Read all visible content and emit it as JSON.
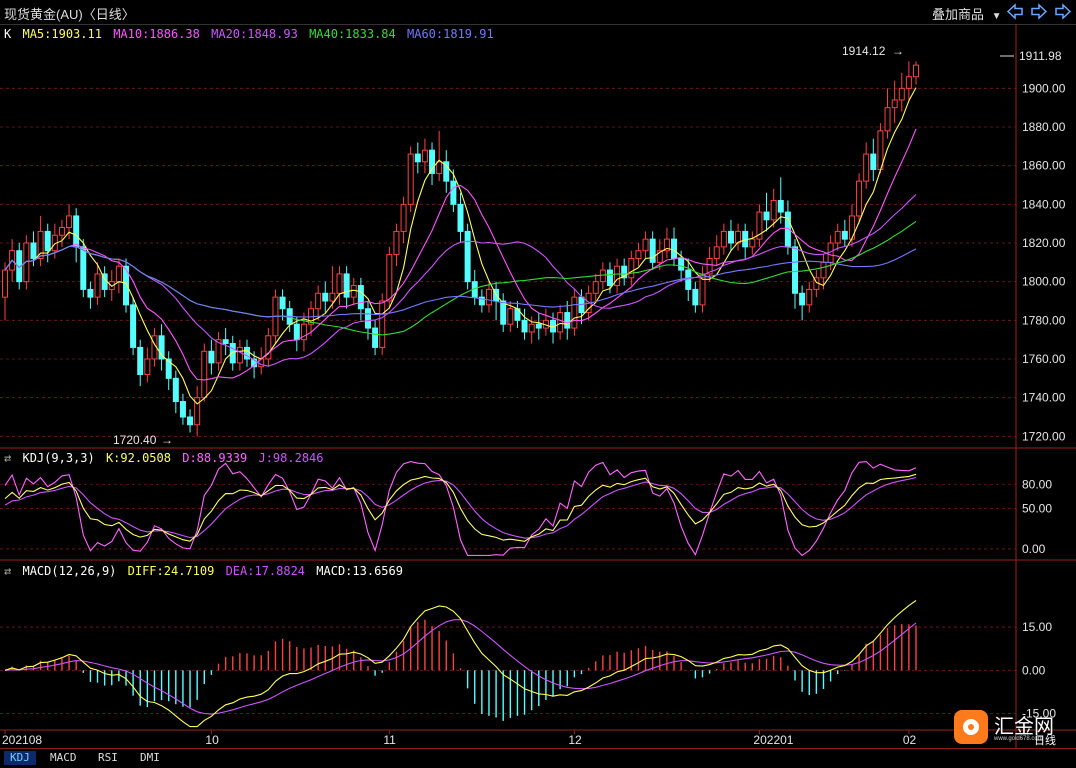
{
  "header": {
    "title": "现货黄金(AU)〈日线〉",
    "overlay_label": "叠加商品"
  },
  "main_legend": {
    "k": "K",
    "ma5": "MA5:1903.11",
    "ma10": "MA10:1886.38",
    "ma20": "MA20:1848.93",
    "ma40": "MA40:1833.84",
    "ma60": "MA60:1819.91"
  },
  "kdj_legend": {
    "name": "KDJ(9,3,3)",
    "k": "K:92.0508",
    "d": "D:88.9339",
    "j": "J:98.2846"
  },
  "macd_legend": {
    "name": "MACD(12,26,9)",
    "diff": "DIFF:24.7109",
    "dea": "DEA:17.8824",
    "macd": "MACD:13.6569"
  },
  "annotations": {
    "high": "1914.12",
    "low": "1720.40",
    "last_price": "1911.98"
  },
  "date_labels": [
    "202108",
    "10",
    "11",
    "12",
    "202201",
    "02"
  ],
  "tabs": [
    "KDJ",
    "MACD",
    "RSI",
    "DMI"
  ],
  "logo": {
    "text": "汇金网",
    "url": "www.gold678.com",
    "period": "日线"
  },
  "colors": {
    "up": "#ff4040",
    "down": "#54ffff",
    "ma5": "#ffff55",
    "ma10": "#ff55ff",
    "ma20": "#cc55ff",
    "ma40": "#33dd33",
    "ma60": "#7777ff",
    "kdj_k": "#ffff66",
    "kdj_d": "#ff66ff",
    "kdj_j": "#cc55ff",
    "diff": "#ffff55",
    "dea": "#cc55ff"
  },
  "chart_data": [
    {
      "type": "candlestick",
      "title": "现货黄金(AU) 日线",
      "ylim": [
        1715,
        1925
      ],
      "yticks": [
        1720,
        1740,
        1760,
        1780,
        1800,
        1820,
        1840,
        1860,
        1880,
        1900
      ],
      "ytick_labels": [
        "1720.00",
        "1740.00",
        "1760.00",
        "1780.00",
        "1800.00",
        "1820.00",
        "1840.00",
        "1860.00",
        "1880.00",
        "1900.00"
      ],
      "candles": [
        [
          1792,
          1806,
          1780,
          1810
        ],
        [
          1806,
          1816,
          1800,
          1822
        ],
        [
          1816,
          1800,
          1796,
          1820
        ],
        [
          1800,
          1820,
          1796,
          1824
        ],
        [
          1820,
          1812,
          1808,
          1826
        ],
        [
          1812,
          1826,
          1808,
          1834
        ],
        [
          1826,
          1816,
          1810,
          1830
        ],
        [
          1816,
          1824,
          1812,
          1830
        ],
        [
          1824,
          1828,
          1818,
          1832
        ],
        [
          1828,
          1834,
          1822,
          1840
        ],
        [
          1834,
          1818,
          1810,
          1838
        ],
        [
          1818,
          1796,
          1792,
          1822
        ],
        [
          1796,
          1792,
          1786,
          1800
        ],
        [
          1792,
          1804,
          1788,
          1810
        ],
        [
          1804,
          1796,
          1792,
          1808
        ],
        [
          1796,
          1800,
          1790,
          1806
        ],
        [
          1800,
          1808,
          1794,
          1812
        ],
        [
          1808,
          1788,
          1784,
          1812
        ],
        [
          1788,
          1766,
          1762,
          1792
        ],
        [
          1766,
          1752,
          1746,
          1770
        ],
        [
          1752,
          1760,
          1748,
          1766
        ],
        [
          1760,
          1772,
          1756,
          1776
        ],
        [
          1772,
          1760,
          1754,
          1778
        ],
        [
          1760,
          1750,
          1744,
          1764
        ],
        [
          1750,
          1738,
          1732,
          1754
        ],
        [
          1738,
          1730,
          1726,
          1742
        ],
        [
          1730,
          1726,
          1722,
          1734
        ],
        [
          1726,
          1740,
          1720,
          1746
        ],
        [
          1740,
          1764,
          1738,
          1768
        ],
        [
          1764,
          1758,
          1752,
          1770
        ],
        [
          1758,
          1770,
          1754,
          1774
        ],
        [
          1770,
          1768,
          1762,
          1776
        ],
        [
          1768,
          1758,
          1754,
          1772
        ],
        [
          1758,
          1766,
          1754,
          1770
        ],
        [
          1766,
          1760,
          1756,
          1770
        ],
        [
          1760,
          1756,
          1750,
          1764
        ],
        [
          1756,
          1760,
          1752,
          1766
        ],
        [
          1760,
          1772,
          1756,
          1776
        ],
        [
          1772,
          1792,
          1768,
          1796
        ],
        [
          1792,
          1786,
          1780,
          1796
        ],
        [
          1786,
          1778,
          1774,
          1790
        ],
        [
          1778,
          1770,
          1764,
          1782
        ],
        [
          1770,
          1778,
          1764,
          1784
        ],
        [
          1778,
          1786,
          1772,
          1790
        ],
        [
          1786,
          1794,
          1780,
          1798
        ],
        [
          1794,
          1790,
          1784,
          1800
        ],
        [
          1790,
          1794,
          1786,
          1808
        ],
        [
          1794,
          1804,
          1788,
          1808
        ],
        [
          1804,
          1792,
          1786,
          1808
        ],
        [
          1792,
          1798,
          1788,
          1802
        ],
        [
          1798,
          1786,
          1780,
          1802
        ],
        [
          1786,
          1776,
          1770,
          1790
        ],
        [
          1776,
          1766,
          1762,
          1780
        ],
        [
          1766,
          1790,
          1762,
          1794
        ],
        [
          1790,
          1814,
          1786,
          1818
        ],
        [
          1814,
          1826,
          1808,
          1830
        ],
        [
          1826,
          1840,
          1820,
          1844
        ],
        [
          1840,
          1866,
          1836,
          1870
        ],
        [
          1866,
          1862,
          1856,
          1872
        ],
        [
          1862,
          1868,
          1856,
          1874
        ],
        [
          1868,
          1856,
          1850,
          1872
        ],
        [
          1856,
          1862,
          1852,
          1878
        ],
        [
          1862,
          1852,
          1846,
          1868
        ],
        [
          1852,
          1840,
          1836,
          1858
        ],
        [
          1840,
          1826,
          1820,
          1846
        ],
        [
          1826,
          1800,
          1796,
          1830
        ],
        [
          1800,
          1792,
          1788,
          1806
        ],
        [
          1792,
          1788,
          1784,
          1796
        ],
        [
          1788,
          1796,
          1784,
          1800
        ],
        [
          1796,
          1790,
          1780,
          1800
        ],
        [
          1790,
          1778,
          1774,
          1794
        ],
        [
          1778,
          1786,
          1774,
          1790
        ],
        [
          1786,
          1780,
          1776,
          1790
        ],
        [
          1780,
          1774,
          1770,
          1786
        ],
        [
          1774,
          1778,
          1768,
          1782
        ],
        [
          1778,
          1776,
          1770,
          1784
        ],
        [
          1776,
          1780,
          1772,
          1786
        ],
        [
          1780,
          1774,
          1768,
          1784
        ],
        [
          1774,
          1784,
          1770,
          1788
        ],
        [
          1784,
          1776,
          1770,
          1790
        ],
        [
          1776,
          1792,
          1772,
          1796
        ],
        [
          1792,
          1784,
          1778,
          1796
        ],
        [
          1784,
          1794,
          1780,
          1798
        ],
        [
          1794,
          1800,
          1790,
          1804
        ],
        [
          1800,
          1806,
          1796,
          1810
        ],
        [
          1806,
          1798,
          1794,
          1810
        ],
        [
          1798,
          1808,
          1794,
          1812
        ],
        [
          1808,
          1802,
          1798,
          1812
        ],
        [
          1802,
          1812,
          1798,
          1816
        ],
        [
          1812,
          1816,
          1808,
          1820
        ],
        [
          1816,
          1822,
          1812,
          1826
        ],
        [
          1822,
          1810,
          1806,
          1826
        ],
        [
          1810,
          1816,
          1806,
          1822
        ],
        [
          1816,
          1822,
          1812,
          1828
        ],
        [
          1822,
          1812,
          1808,
          1828
        ],
        [
          1812,
          1806,
          1800,
          1816
        ],
        [
          1806,
          1796,
          1790,
          1812
        ],
        [
          1796,
          1788,
          1784,
          1800
        ],
        [
          1788,
          1804,
          1784,
          1808
        ],
        [
          1804,
          1812,
          1800,
          1818
        ],
        [
          1812,
          1818,
          1808,
          1824
        ],
        [
          1818,
          1826,
          1814,
          1830
        ],
        [
          1826,
          1820,
          1816,
          1832
        ],
        [
          1820,
          1826,
          1816,
          1830
        ],
        [
          1826,
          1818,
          1812,
          1830
        ],
        [
          1818,
          1822,
          1814,
          1826
        ],
        [
          1822,
          1836,
          1818,
          1840
        ],
        [
          1836,
          1832,
          1826,
          1846
        ],
        [
          1832,
          1842,
          1828,
          1848
        ],
        [
          1842,
          1836,
          1830,
          1854
        ],
        [
          1836,
          1818,
          1814,
          1842
        ],
        [
          1818,
          1794,
          1786,
          1822
        ],
        [
          1794,
          1788,
          1780,
          1798
        ],
        [
          1788,
          1796,
          1784,
          1800
        ],
        [
          1796,
          1802,
          1792,
          1806
        ],
        [
          1802,
          1810,
          1796,
          1814
        ],
        [
          1810,
          1820,
          1806,
          1824
        ],
        [
          1820,
          1826,
          1816,
          1830
        ],
        [
          1826,
          1822,
          1818,
          1832
        ],
        [
          1822,
          1834,
          1818,
          1840
        ],
        [
          1834,
          1852,
          1830,
          1856
        ],
        [
          1852,
          1866,
          1848,
          1872
        ],
        [
          1866,
          1858,
          1852,
          1874
        ],
        [
          1858,
          1878,
          1856,
          1882
        ],
        [
          1878,
          1890,
          1874,
          1900
        ],
        [
          1890,
          1894,
          1882,
          1904
        ],
        [
          1894,
          1900,
          1888,
          1908
        ],
        [
          1900,
          1906,
          1894,
          1914
        ],
        [
          1906,
          1912,
          1902,
          1914
        ]
      ]
    },
    {
      "type": "line",
      "title": "KDJ(9,3,3)",
      "ylim": [
        -10,
        110
      ],
      "yticks": [
        0,
        50,
        80
      ],
      "ytick_labels": [
        "0.00",
        "50.00",
        "80.00"
      ]
    },
    {
      "type": "bar",
      "title": "MACD(12,26,9)",
      "ylim": [
        -20,
        32
      ],
      "yticks": [
        -15,
        0,
        15
      ],
      "ytick_labels": [
        "-15.00",
        "0.00",
        "15.00"
      ]
    }
  ]
}
